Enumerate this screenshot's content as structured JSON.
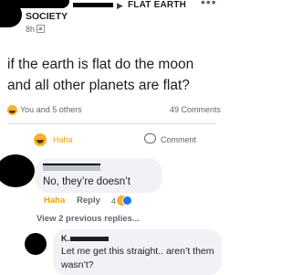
{
  "post": {
    "group_name": "FLAT EARTH",
    "arrow": "▶",
    "more": "•••",
    "group_sub": "SOCIETY",
    "time": "8h ·",
    "text": "if the earth is flat do the moon and all other planets are flat?"
  },
  "reactions": {
    "summary": "You and 5 others",
    "comments": "49 Comments"
  },
  "actions": {
    "haha": "Haha",
    "comment": "Comment"
  },
  "comment1": {
    "text": "No, they’re doesn’t",
    "haha": "Haha",
    "reply": "Reply",
    "reaction_count": "4"
  },
  "view_replies": "View 2 previous replies...",
  "comment2": {
    "name": "K...",
    "text": "Let me get this straight.. aren’t them wasn’t?"
  },
  "colors": {
    "haha_orange": "#f0a10f",
    "bubble_gray": "#f0f2f5",
    "meta_gray": "#606770",
    "like_blue": "#1877f2"
  },
  "icons": [
    "globe-icon",
    "more-icon",
    "haha-icon",
    "comment-icon",
    "like-icon"
  ]
}
